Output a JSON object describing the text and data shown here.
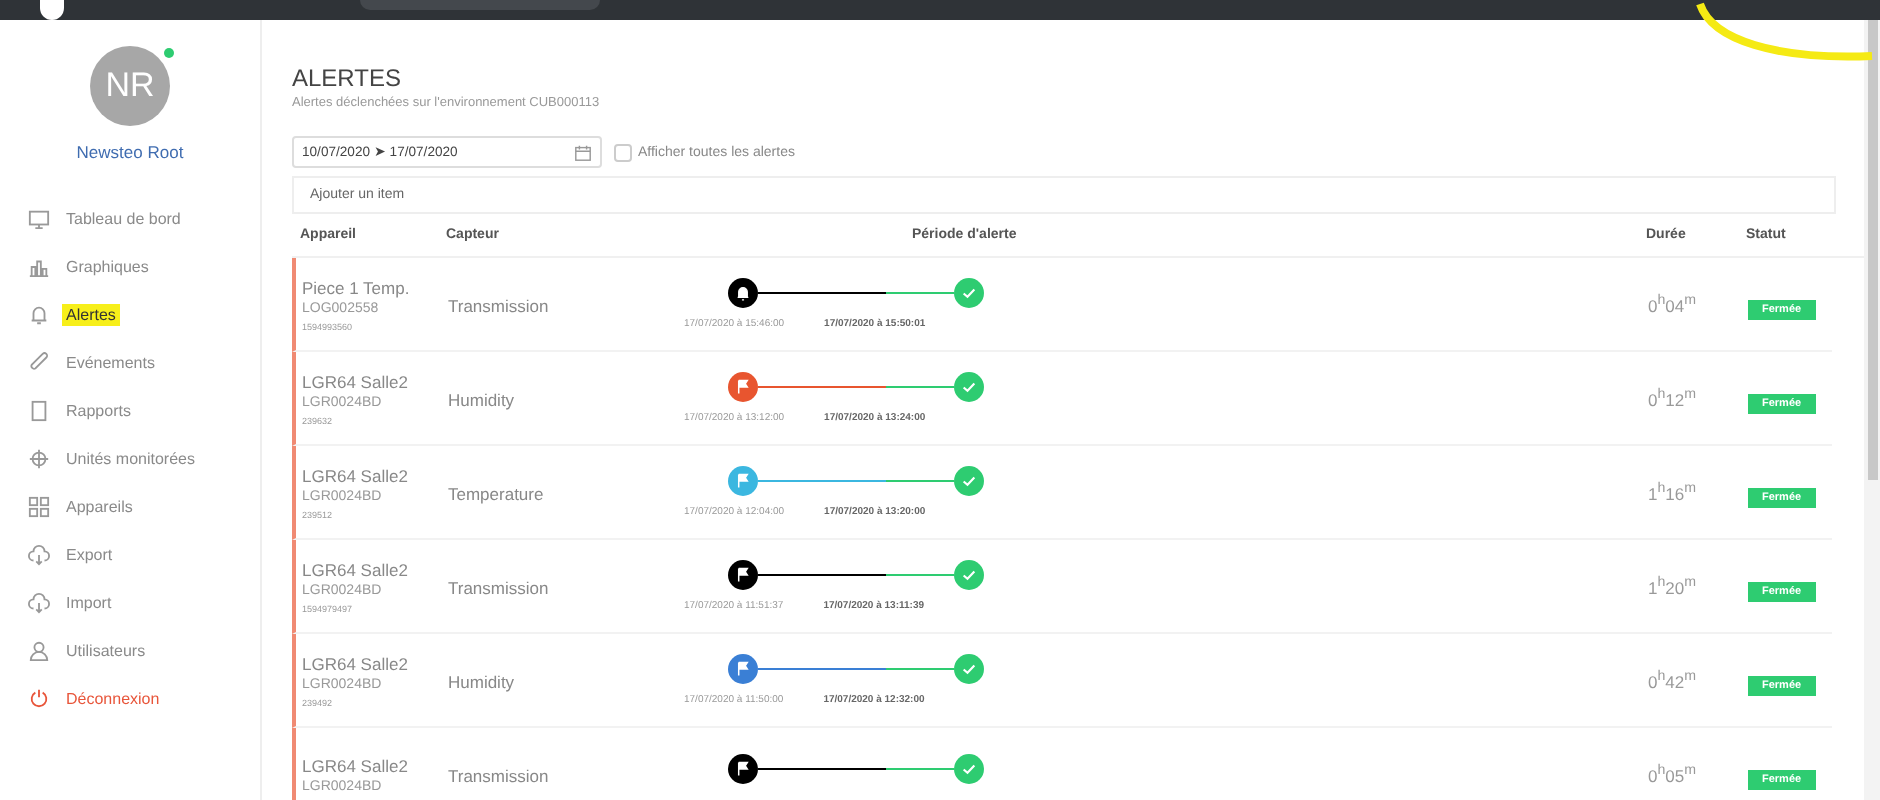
{
  "user": {
    "initials": "NR",
    "name": "Newsteo Root",
    "online": true
  },
  "sidebar": {
    "items": [
      {
        "label": "Tableau de bord",
        "selected": false,
        "highlighted": false,
        "kind": "nav"
      },
      {
        "label": "Graphiques",
        "selected": false,
        "highlighted": false,
        "kind": "nav"
      },
      {
        "label": "Alertes",
        "selected": true,
        "highlighted": true,
        "kind": "nav"
      },
      {
        "label": "Evénements",
        "selected": false,
        "highlighted": false,
        "kind": "nav"
      },
      {
        "label": "Rapports",
        "selected": false,
        "highlighted": false,
        "kind": "nav"
      },
      {
        "label": "Unités monitorées",
        "selected": false,
        "highlighted": false,
        "kind": "nav"
      },
      {
        "label": "Appareils",
        "selected": false,
        "highlighted": false,
        "kind": "nav"
      },
      {
        "label": "Export",
        "selected": false,
        "highlighted": false,
        "kind": "nav"
      },
      {
        "label": "Import",
        "selected": false,
        "highlighted": false,
        "kind": "nav"
      },
      {
        "label": "Utilisateurs",
        "selected": false,
        "highlighted": false,
        "kind": "nav"
      },
      {
        "label": "Déconnexion",
        "selected": false,
        "highlighted": false,
        "kind": "logout"
      }
    ]
  },
  "page": {
    "title": "ALERTES",
    "subtitle": "Alertes déclenchées sur l'environnement CUB000113"
  },
  "filters": {
    "date_range": "10/07/2020 ➤ 17/07/2020",
    "show_all": {
      "label": "Afficher toutes les alertes",
      "checked": false
    },
    "add_item": {
      "placeholder": "Ajouter un item"
    }
  },
  "table": {
    "columns": [
      "Appareil",
      "Capteur",
      "Période d'alerte",
      "Durée",
      "Statut"
    ],
    "rows": [
      {
        "device": "Piece 1 Temp.",
        "serial": "LOG002558",
        "id": "1594993560",
        "sensor": "Transmission",
        "kind": "bell",
        "color": "#000000",
        "start": "17/07/2020 à 15:46:00",
        "end": "17/07/2020 à 15:50:01",
        "duration": "0$^{h}$04$^{m}$",
        "status": "Fermée"
      },
      {
        "device": "LGR64 Salle2",
        "serial": "LGR0024BD",
        "id": "239632",
        "sensor": "Humidity",
        "kind": "flag",
        "color": "#e8552f",
        "start": "17/07/2020 à 13:12:00",
        "end": "17/07/2020 à 13:24:00",
        "duration": "0$^{h}$12$^{m}$",
        "status": "Fermée"
      },
      {
        "device": "LGR64 Salle2",
        "serial": "LGR0024BD",
        "id": "239512",
        "sensor": "Temperature",
        "kind": "flag",
        "color": "#3bb7e0",
        "start": "17/07/2020 à 12:04:00",
        "end": "17/07/2020 à 13:20:00",
        "duration": "1$^{h}$16$^{m}$",
        "status": "Fermée"
      },
      {
        "device": "LGR64 Salle2",
        "serial": "LGR0024BD",
        "id": "1594979497",
        "sensor": "Transmission",
        "kind": "flag",
        "color": "#000000",
        "start": "17/07/2020 à 11:51:37",
        "end": "17/07/2020 à 13:11:39",
        "duration": "1$^{h}$20$^{m}$",
        "status": "Fermée"
      },
      {
        "device": "LGR64 Salle2",
        "serial": "LGR0024BD",
        "id": "239492",
        "sensor": "Humidity",
        "kind": "flag",
        "color": "#3a7fd5",
        "start": "17/07/2020 à 11:50:00",
        "end": "17/07/2020 à 12:32:00",
        "duration": "0$^{h}$42$^{m}$",
        "status": "Fermée"
      },
      {
        "device": "LGR64 Salle2",
        "serial": "LGR0024BD",
        "sensor": "Transmission",
        "kind": "flag",
        "color": "#000000",
        "duration": "0$^{h}$05$^{m}$",
        "status": "Fermée"
      }
    ]
  }
}
